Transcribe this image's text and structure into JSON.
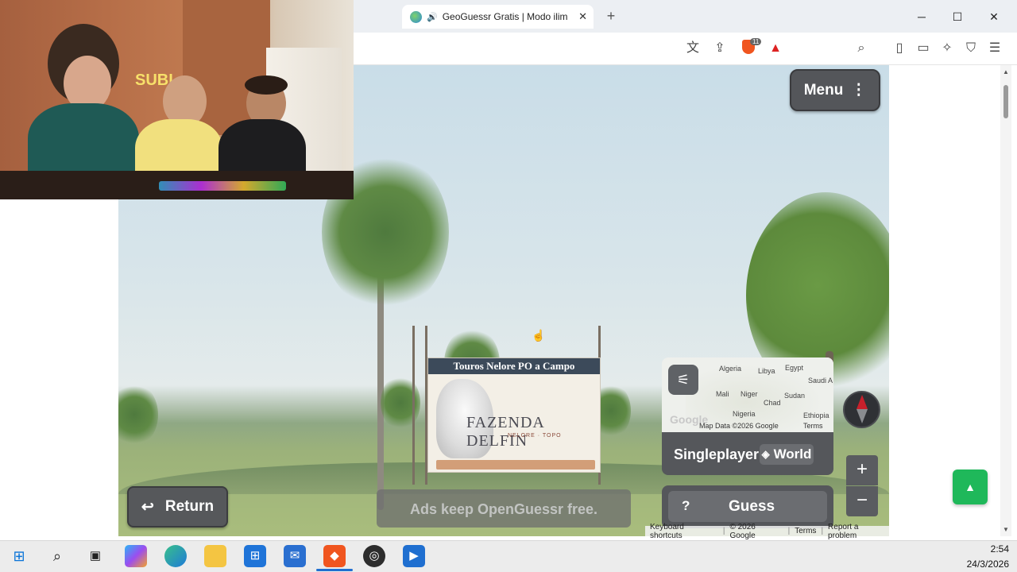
{
  "browser": {
    "tab_title": "GeoGuessr Gratis | Modo ilim",
    "shield_badge": "11",
    "window_buttons": {
      "minimize": "─",
      "maximize": "☐",
      "close": "✕"
    }
  },
  "game": {
    "menu_label": "Menu",
    "return_label": "Return",
    "ads_text": "Ads keep OpenGuessr free.",
    "mode_label": "Singleplayer",
    "map_label": "World",
    "guess_label": "Guess",
    "guess_help": "?",
    "zoom_in": "+",
    "zoom_out": "−"
  },
  "minimap": {
    "country_labels": [
      "Algeria",
      "Libya",
      "Egypt",
      "Saudi A",
      "Mali",
      "Niger",
      "Sudan",
      "Chad",
      "Nigeria",
      "Ethiopia"
    ],
    "google_logo": "Google",
    "map_data": "Map Data ©2026 Google",
    "terms": "Terms"
  },
  "panorama": {
    "sign_header": "Touros Nelore PO a Campo",
    "sign_brand": "FAZENDA DELFIN",
    "sign_sub": "NELORE · TOPO"
  },
  "attribution": {
    "shortcuts": "Keyboard shortcuts",
    "copyright": "© 2026 Google",
    "terms": "Terms",
    "report": "Report a problem"
  },
  "webcam": {
    "wall_text": "SUBI"
  },
  "taskbar": {
    "time": "2:54",
    "date": "24/3/2026"
  },
  "colors": {
    "scroll_top_button": "#1fb85a",
    "game_button": "#55575b",
    "compass_north": "#c8202b"
  }
}
